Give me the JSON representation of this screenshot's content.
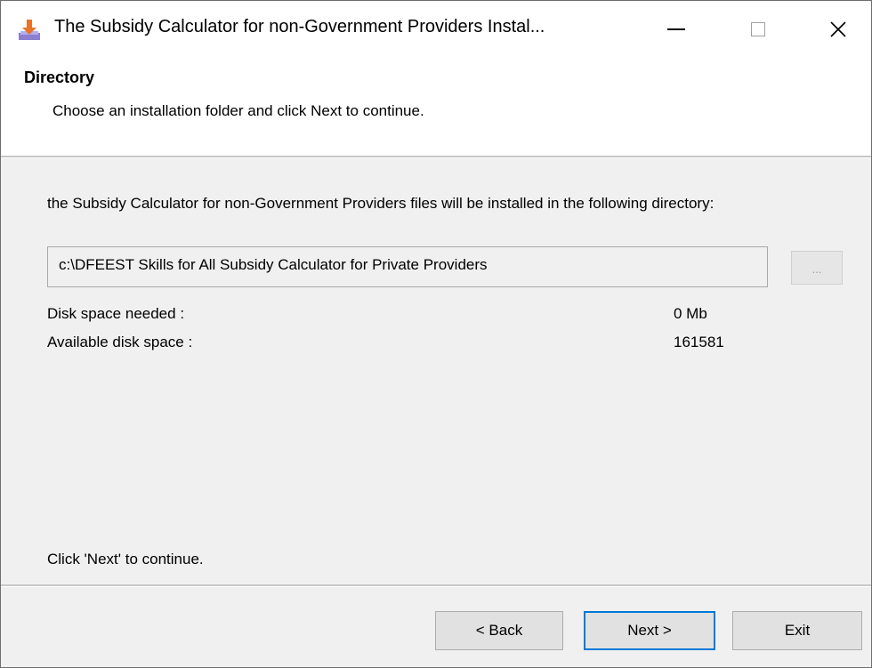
{
  "window": {
    "title": "The Subsidy Calculator for non-Government Providers Instal...",
    "icon": "installer-icon"
  },
  "header": {
    "title": "Directory",
    "subtitle": "Choose an installation folder and click Next to continue."
  },
  "body": {
    "description": "the Subsidy Calculator for non-Government Providers files will be installed in the following directory:",
    "directory_value": "c:\\DFEEST Skills for All Subsidy Calculator for Private Providers",
    "browse_label": "...",
    "disk_needed_label": "Disk space needed :",
    "disk_needed_value": "0 Mb",
    "disk_available_label": "Available disk space :",
    "disk_available_value": "161581",
    "footer_hint": "Click 'Next' to continue."
  },
  "buttons": {
    "back": "< Back",
    "next": "Next >",
    "exit": "Exit"
  },
  "colors": {
    "accent": "#0078d7",
    "dialog_bg": "#f0f0f0"
  }
}
